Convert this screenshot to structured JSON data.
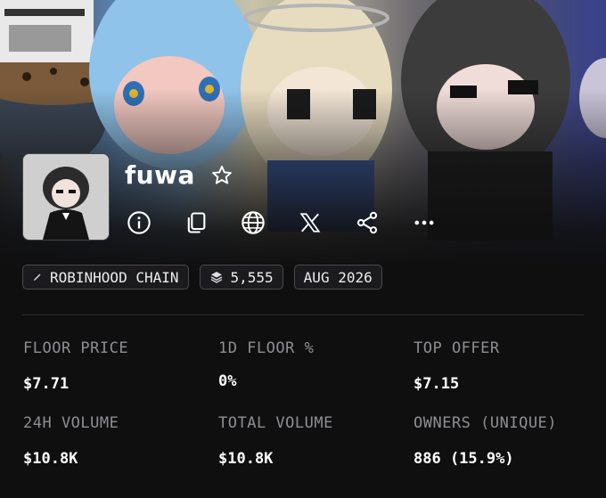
{
  "collection": {
    "name": "fuwa"
  },
  "actions": {
    "favorite_icon": "star-icon",
    "info_icon": "info-icon",
    "copy_icon": "copy-icon",
    "website_icon": "globe-icon",
    "x_icon": "x-logo-icon",
    "share_icon": "share-icon",
    "more_icon": "more-icon"
  },
  "tags": [
    {
      "icon": "pencil-icon",
      "label": "ROBINHOOD CHAIN"
    },
    {
      "icon": "layers-icon",
      "label": "5,555"
    },
    {
      "label": "AUG 2026"
    }
  ],
  "stats": [
    {
      "label": "FLOOR PRICE",
      "value": "$7.71"
    },
    {
      "label": "1D FLOOR %",
      "value": "0%"
    },
    {
      "label": "TOP OFFER",
      "value": "$7.15"
    },
    {
      "label": "24H VOLUME",
      "value": "$10.8K"
    },
    {
      "label": "TOTAL VOLUME",
      "value": "$10.8K"
    },
    {
      "label": "OWNERS (UNIQUE)",
      "value": "886 (15.9%)"
    }
  ],
  "colors": {
    "background": "#0f0f10",
    "label": "#8e8e93",
    "value": "#ffffff",
    "tag_border": "#4a4a4e"
  }
}
